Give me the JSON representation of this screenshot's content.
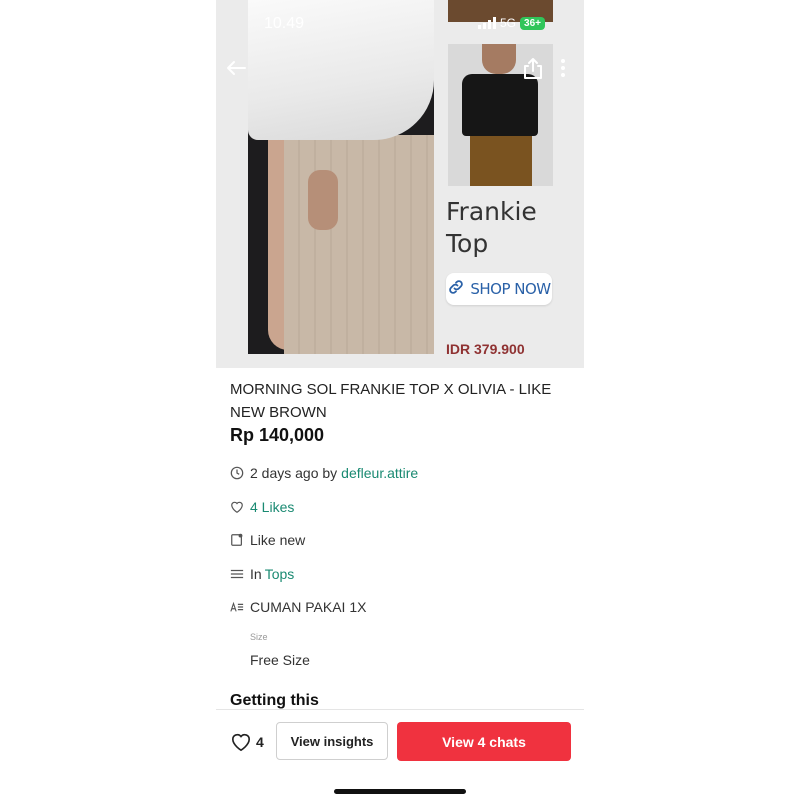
{
  "status_bar": {
    "time": "10.49",
    "network": "5G",
    "battery": "36+"
  },
  "hero": {
    "promo_title_line1": "Frankie",
    "promo_title_line2": "Top",
    "shop_now_label": "SHOP NOW",
    "promo_price": "IDR 379.900"
  },
  "listing": {
    "title": "MORNING SOL FRANKIE TOP X OLIVIA - LIKE NEW BROWN",
    "price": "Rp 140,000",
    "posted": "2 days ago by",
    "seller": "defleur.attire",
    "likes": "4 Likes",
    "condition": "Like new",
    "category_prefix": "In",
    "category": "Tops",
    "description": "CUMAN PAKAI 1X",
    "size_label": "Size",
    "size_value": "Free Size",
    "section_heading": "Getting this"
  },
  "bottom_bar": {
    "like_count": "4",
    "insights_label": "View insights",
    "chats_label": "View 4 chats"
  },
  "colors": {
    "accent_green": "#1a8a72",
    "cta_red": "#f0323f",
    "promo_price": "#8f3232",
    "shop_now_blue": "#2a61a8"
  }
}
